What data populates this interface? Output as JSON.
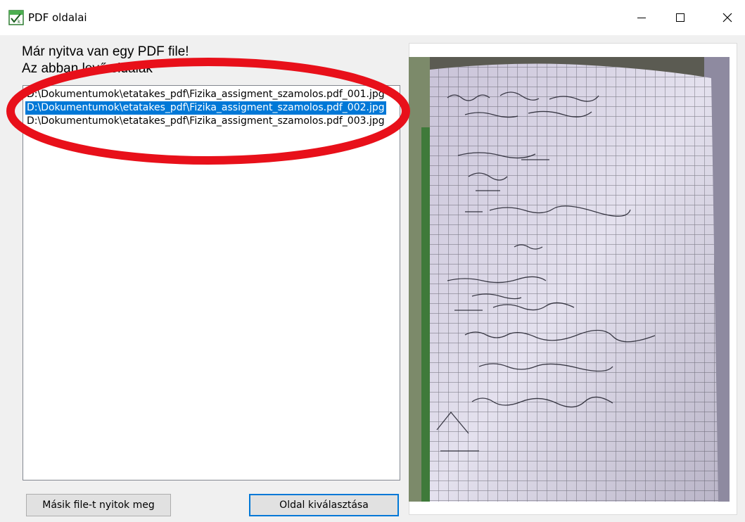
{
  "window": {
    "title": "PDF oldalai",
    "controls": {
      "minimize": "—",
      "maximize": "☐",
      "close": "✕"
    }
  },
  "header": {
    "line1": "Már nyitva van egy PDF file!",
    "line2": "Az abban levő oldalak"
  },
  "pages_list": {
    "items": [
      {
        "label": "D:\\Dokumentumok\\etatakes_pdf\\Fizika_assigment_szamolos.pdf_001.jpg",
        "selected": false
      },
      {
        "label": "D:\\Dokumentumok\\etatakes_pdf\\Fizika_assigment_szamolos.pdf_002.jpg",
        "selected": true
      },
      {
        "label": "D:\\Dokumentumok\\etatakes_pdf\\Fizika_assigment_szamolos.pdf_003.jpg",
        "selected": false
      }
    ]
  },
  "buttons": {
    "other_file": "Másik file-t nyitok meg",
    "select_page": "Oldal kiválasztása"
  },
  "colors": {
    "selection": "#0078d7",
    "annotation": "#e8101a"
  },
  "icons": {
    "app": "spreadsheet-check-icon",
    "minimize": "minimize-icon",
    "maximize": "maximize-icon",
    "close": "close-icon"
  }
}
